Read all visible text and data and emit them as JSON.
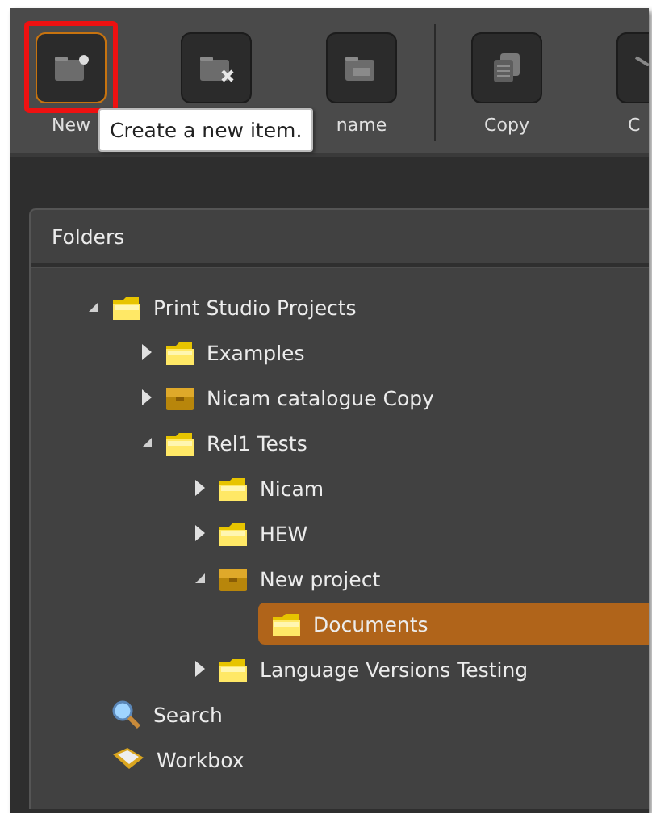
{
  "toolbar": {
    "groups": [
      [
        {
          "kind": "new",
          "label": "New",
          "highlighted": true
        },
        {
          "kind": "delete",
          "highlighted": false
        },
        {
          "kind": "rename",
          "label": "name",
          "highlighted": false
        }
      ],
      [
        {
          "kind": "copy",
          "label": "Copy",
          "highlighted": false
        },
        {
          "kind": "other",
          "label": "C",
          "highlighted": false
        }
      ]
    ]
  },
  "tooltip": {
    "text": "Create a new item."
  },
  "panel": {
    "title": "Folders",
    "tree": [
      {
        "label": "Print Studio Projects",
        "kind": "folder",
        "expanded": true,
        "selected": false,
        "children": [
          {
            "label": "Examples",
            "kind": "folder",
            "expanded": false,
            "selected": false
          },
          {
            "label": "Nicam catalogue Copy",
            "kind": "project",
            "expanded": false,
            "selected": false
          },
          {
            "label": "Rel1 Tests",
            "kind": "folder",
            "expanded": true,
            "selected": false,
            "children": [
              {
                "label": "Nicam",
                "kind": "folder",
                "expanded": false,
                "selected": false
              },
              {
                "label": "HEW",
                "kind": "folder",
                "expanded": false,
                "selected": false
              },
              {
                "label": "New project",
                "kind": "project",
                "expanded": true,
                "selected": false,
                "children": [
                  {
                    "label": "Documents",
                    "kind": "folder",
                    "selected": true
                  }
                ]
              },
              {
                "label": "Language Versions Testing",
                "kind": "folder",
                "expanded": false,
                "selected": false
              }
            ]
          }
        ]
      },
      {
        "label": "Search",
        "kind": "search",
        "selected": false
      },
      {
        "label": "Workbox",
        "kind": "workbox",
        "selected": false
      }
    ]
  }
}
